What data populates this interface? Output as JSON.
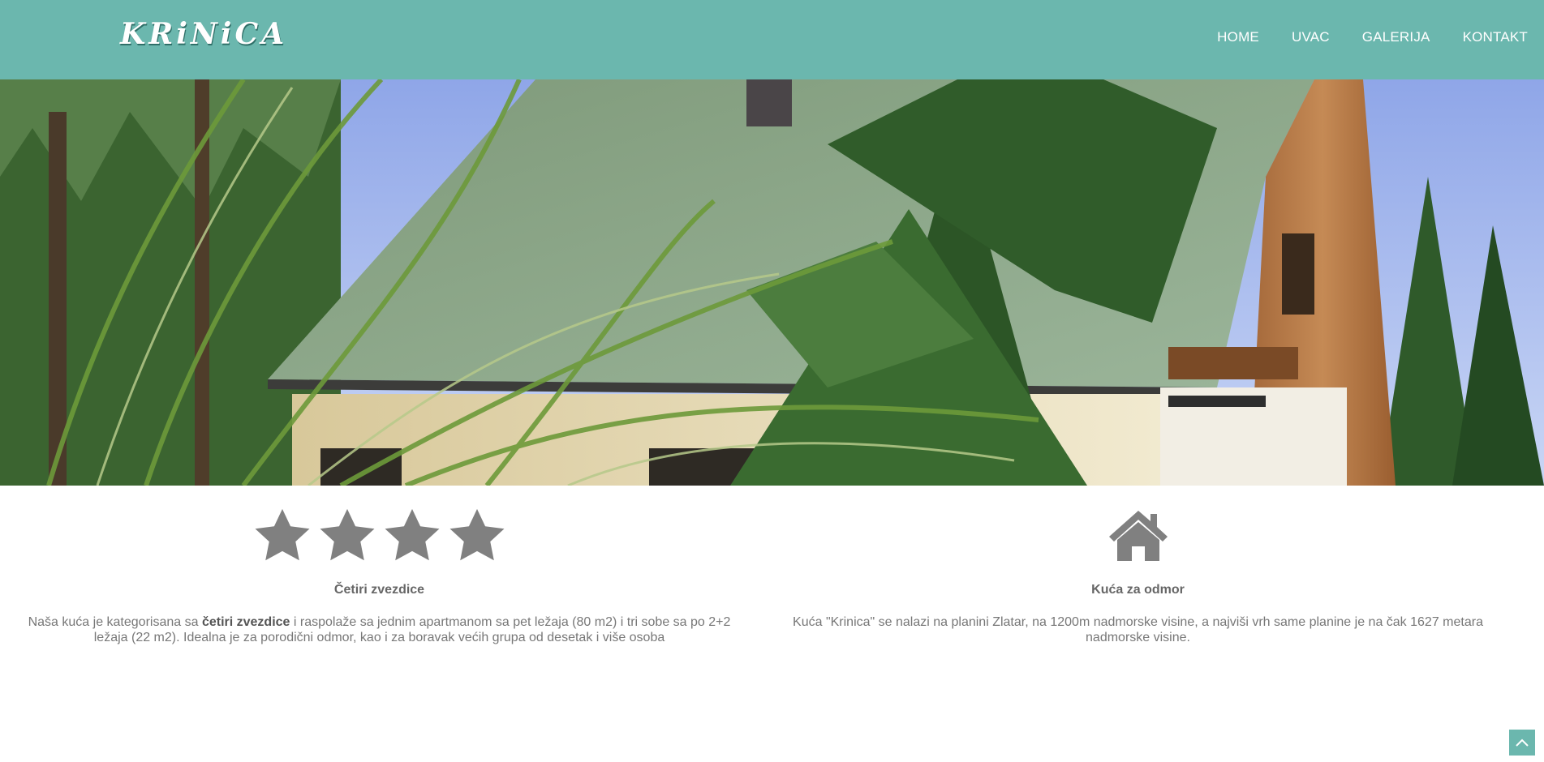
{
  "header": {
    "logo_text": "KRiNiCA",
    "nav": [
      {
        "label": "HOME"
      },
      {
        "label": "UVAC"
      },
      {
        "label": "GALERIJA"
      },
      {
        "label": "KONTAKT"
      }
    ]
  },
  "hero": {
    "image_desc": "photo of a wooden house with green roof among pine trees"
  },
  "features": {
    "left": {
      "icon": "four-stars-icon",
      "star_count": 4,
      "title": "Četiri zvezdice",
      "text_before": "Naša kuća je kategorisana sa ",
      "text_bold": "četiri zvezdice",
      "text_after": " i raspolaže sa jednim apartmanom sa pet ležaja (80 m2) i tri sobe sa po 2+2 ležaja (22 m2). Idealna je za porodični odmor, kao i za boravak većih grupa od desetak i više osoba"
    },
    "right": {
      "icon": "house-icon",
      "title": "Kuća za odmor",
      "text": "Kuća \"Krinica\" se nalazi na planini Zlatar, na 1200m nadmorske visine, a najviši vrh same planine je na čak 1627 metara nadmorske visine."
    }
  },
  "colors": {
    "header_bg": "#6bb7ae",
    "icon_gray": "#808080",
    "text_gray": "#777777"
  },
  "scroll_top": {
    "icon": "chevron-up-icon"
  }
}
